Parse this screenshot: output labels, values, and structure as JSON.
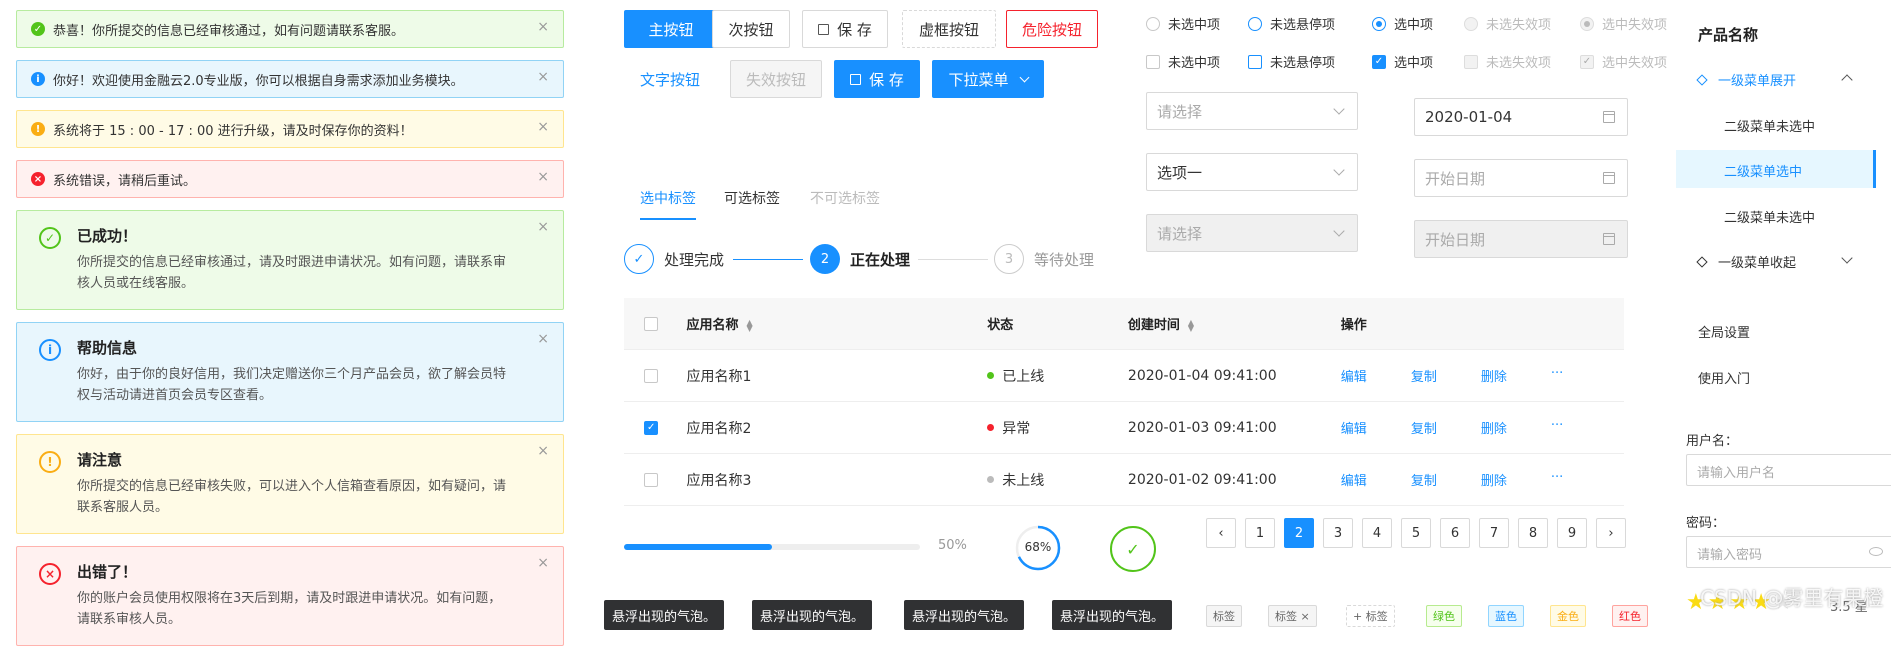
{
  "alerts_small": [
    {
      "text": "恭喜！你所提交的信息已经审核通过，如有问题请联系客服。",
      "type": "green",
      "icon": "check-circle-icon",
      "icon_glyph": "✓",
      "color": "#52c41a"
    },
    {
      "text": "你好！欢迎使用金融云2.0专业版，你可以根据自身需求添加业务模块。",
      "type": "blue",
      "icon": "info-circle-icon",
      "icon_glyph": "i",
      "color": "#1890ff"
    },
    {
      "text": "系统将于 15 : 00 - 17 : 00 进行升级，请及时保存你的资料！",
      "type": "yellow",
      "icon": "warning-circle-icon",
      "icon_glyph": "!",
      "color": "#faad14"
    },
    {
      "text": "系统错误，请稍后重试。",
      "type": "red",
      "icon": "error-circle-icon",
      "icon_glyph": "×",
      "color": "#f5222d"
    }
  ],
  "alerts_large": [
    {
      "title": "已成功！",
      "desc": "你所提交的信息已经审核通过，请及时跟进申请状况。如有问题，请联系审核人员或在线客服。",
      "type": "green",
      "icon": "check-circle-icon",
      "icon_glyph": "✓",
      "color": "#52c41a"
    },
    {
      "title": "帮助信息",
      "desc": "你好，由于你的良好信用，我们决定赠送你三个月产品会员，欲了解会员特权与活动请进首页会员专区查看。",
      "type": "blue",
      "icon": "info-circle-icon",
      "icon_glyph": "i",
      "color": "#1890ff"
    },
    {
      "title": "请注意",
      "desc": "你所提交的信息已经审核失败，可以进入个人信箱查看原因，如有疑问，请联系客服人员。",
      "type": "yellow",
      "icon": "warning-circle-icon",
      "icon_glyph": "!",
      "color": "#faad14"
    },
    {
      "title": "出错了！",
      "desc": "你的账户会员使用权限将在3天后到期，请及时跟进申请状况。如有问题，请联系审核人员。",
      "type": "red",
      "icon": "error-circle-icon",
      "icon_glyph": "×",
      "color": "#f5222d"
    }
  ],
  "close_glyph": "×",
  "buttons": {
    "primary": "主按钮",
    "secondary": "次按钮",
    "save": "保 存",
    "dashed": "虚框按钮",
    "danger": "危险按钮",
    "text": "文字按钮",
    "disabled": "失效按钮",
    "save_primary": "保 存",
    "dropdown": "下拉菜单"
  },
  "radios": [
    "未选中项",
    "未选悬停项",
    "选中项",
    "未选失效项",
    "选中失效项"
  ],
  "checkboxes": [
    "未选中项",
    "未选悬停项",
    "选中项",
    "未选失效项",
    "选中失效项"
  ],
  "check_glyph": "✓",
  "selects": {
    "s1_placeholder": "请选择",
    "s2_value": "选项一",
    "s3_placeholder": "请选择"
  },
  "dates": {
    "d1_value": "2020-01-04",
    "d2_placeholder": "开始日期",
    "d3_placeholder": "开始日期"
  },
  "tabs": [
    "选中标签",
    "可选标签",
    "不可选标签"
  ],
  "steps": [
    {
      "label": "处理完成",
      "glyph": "✓"
    },
    {
      "label": "正在处理",
      "num": "2"
    },
    {
      "label": "等待处理",
      "num": "3"
    }
  ],
  "table": {
    "headers": [
      "应用名称",
      "状态",
      "创建时间",
      "操作"
    ],
    "sort_glyph_up": "▲",
    "sort_glyph_down": "▼",
    "rows": [
      {
        "name": "应用名称1",
        "status": "已上线",
        "status_color": "#52c41a",
        "time": "2020-01-04  09:41:00",
        "checked": false
      },
      {
        "name": "应用名称2",
        "status": "异常",
        "status_color": "#f5222d",
        "time": "2020-01-03  09:41:00",
        "checked": true
      },
      {
        "name": "应用名称3",
        "status": "未上线",
        "status_color": "#bbbbbb",
        "time": "2020-01-02  09:41:00",
        "checked": false
      }
    ],
    "ops": [
      "编辑",
      "复制",
      "删除",
      "···"
    ]
  },
  "progress": {
    "value": 50,
    "label": "50%",
    "circle_value": 68,
    "circle_label": "68%",
    "done_glyph": "✓"
  },
  "pagination": {
    "prev": "‹",
    "next": "›",
    "pages": [
      "1",
      "2",
      "3",
      "4",
      "5",
      "6",
      "7",
      "8",
      "9"
    ],
    "current": "2"
  },
  "tooltips": [
    "悬浮出现的气泡。",
    "悬浮出现的气泡。",
    "悬浮出现的气泡。",
    "悬浮出现的气泡。"
  ],
  "tags": [
    {
      "text": "标签",
      "color": "#666",
      "bg": "#f5f5f5",
      "border": "#d9d9d9"
    },
    {
      "text": "标签 ×",
      "color": "#666",
      "bg": "#f5f5f5",
      "border": "#d9d9d9"
    },
    {
      "text": "+ 标签",
      "color": "#666",
      "bg": "#fff",
      "border": "#d9d9d9"
    },
    {
      "text": "绿色",
      "color": "#52c41a",
      "bg": "#f6ffed",
      "border": "#b7eb8f"
    },
    {
      "text": "蓝色",
      "color": "#1890ff",
      "bg": "#e6f7ff",
      "border": "#91d5ff"
    },
    {
      "text": "金色",
      "color": "#faad14",
      "bg": "#fffbe6",
      "border": "#ffe58f"
    },
    {
      "text": "红色",
      "color": "#f5222d",
      "bg": "#fff1f0",
      "border": "#ffa39e"
    }
  ],
  "menu": {
    "title": "产品名称",
    "l1_expand": "一级菜单展开",
    "l2_a": "二级菜单未选中",
    "l2_selected": "二级菜单选中",
    "l2_b": "二级菜单未选中",
    "l1_collapse": "一级菜单收起",
    "settings": "全局设置",
    "guide": "使用入门"
  },
  "form": {
    "username_label": "用户名：",
    "username_placeholder": "请输入用户名",
    "password_label": "密码：",
    "password_placeholder": "请输入密码"
  },
  "rating": {
    "value": 3.5,
    "max": 5,
    "label": "3.5 星"
  },
  "watermark": "CSDN @雾里有果橙",
  "colors": {
    "primary": "#1890ff",
    "danger": "#f5222d",
    "success": "#52c41a",
    "warning": "#faad14"
  }
}
